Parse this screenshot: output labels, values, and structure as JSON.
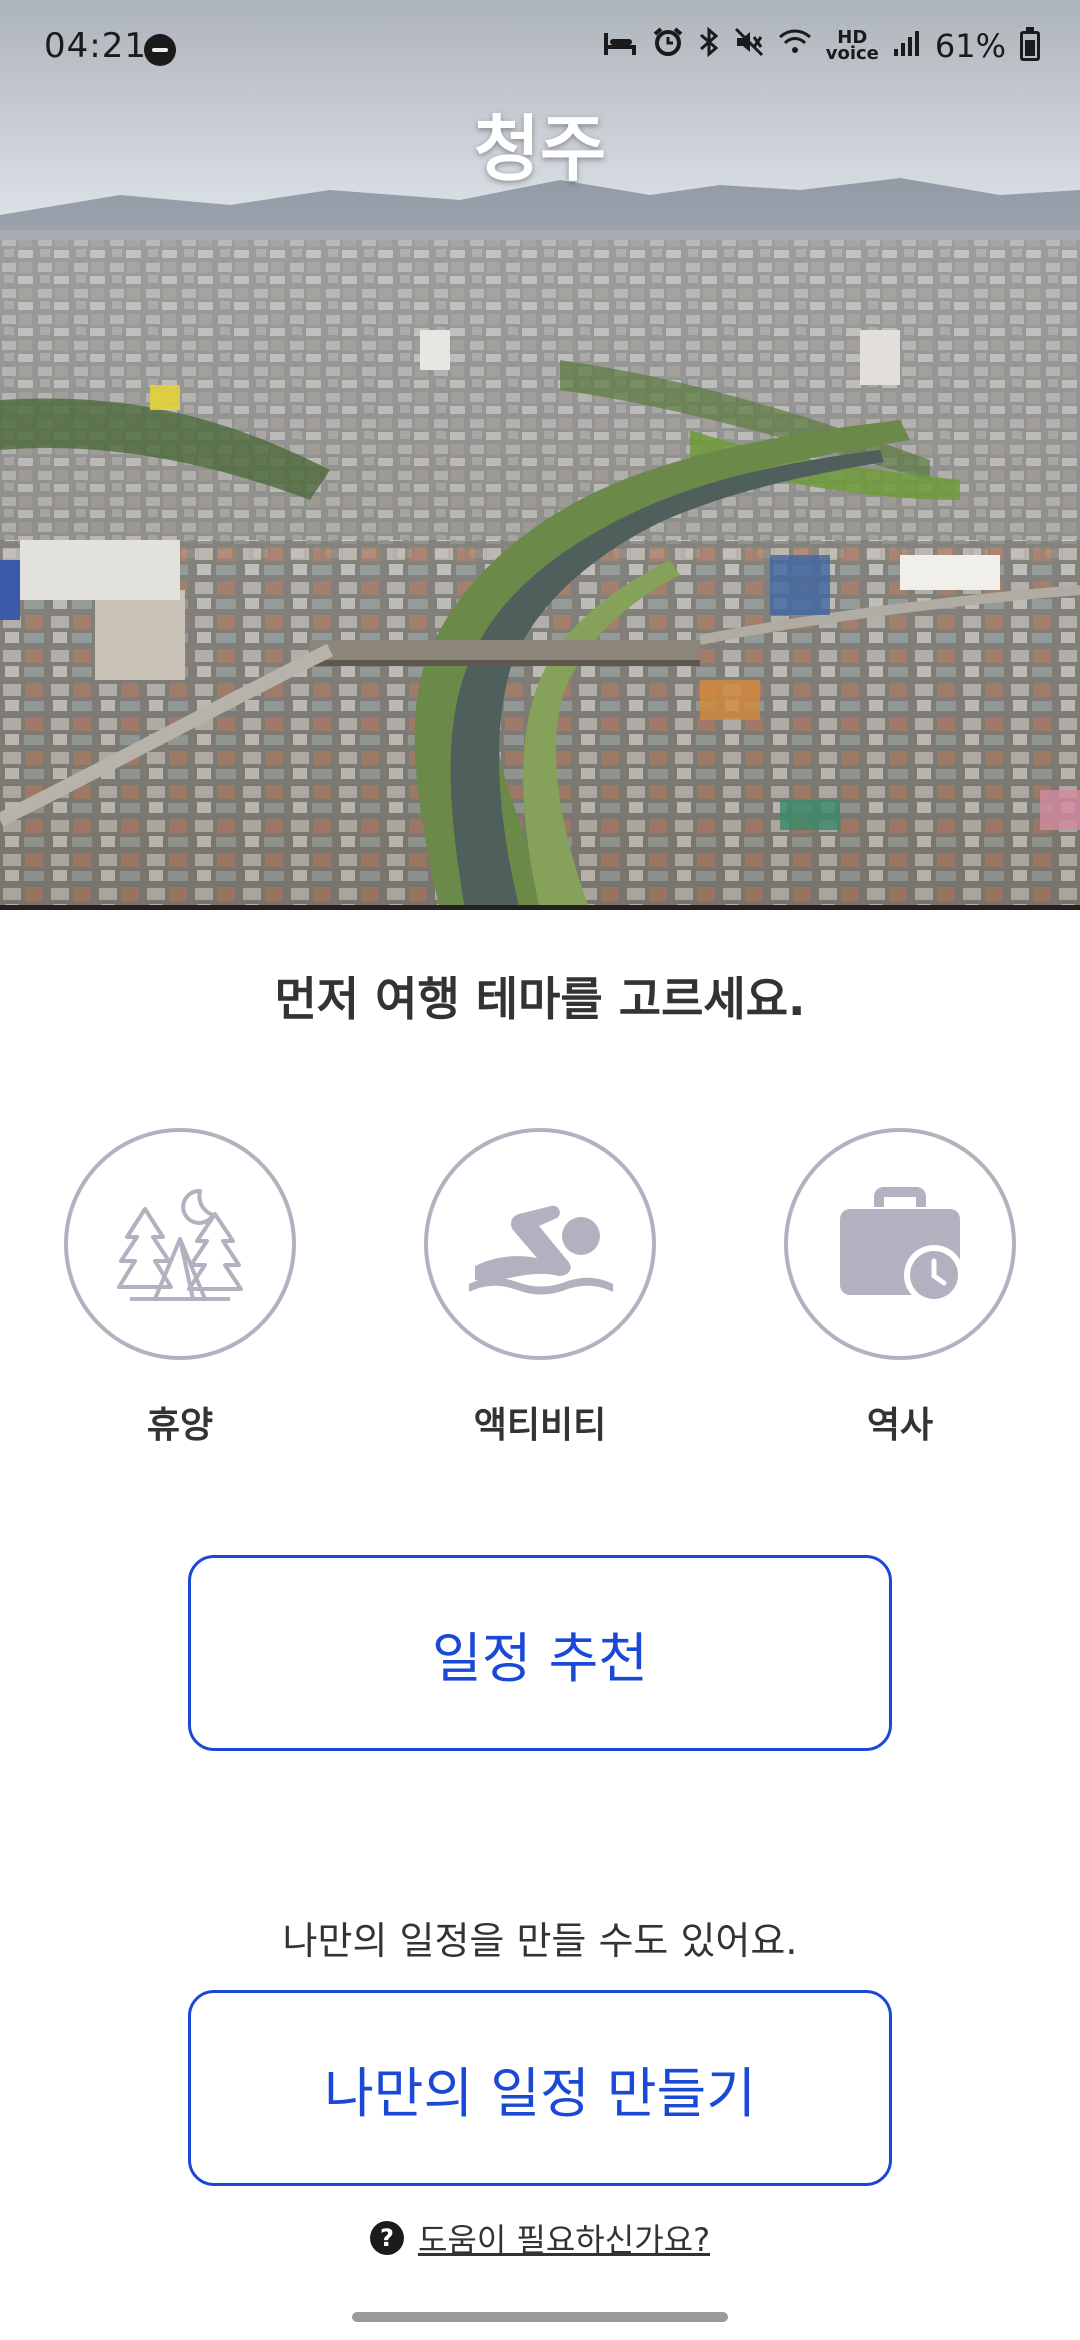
{
  "status_bar": {
    "time": "04:21",
    "battery": "61%",
    "icons": [
      "dnd-icon",
      "sleep-icon",
      "alarm-icon",
      "bluetooth-icon",
      "mute-icon",
      "wifi-icon",
      "hd-voice-icon",
      "signal-icon",
      "battery-icon"
    ],
    "hd_voice_line1": "HD",
    "hd_voice_line2": "voice"
  },
  "hero": {
    "city": "청주"
  },
  "prompt": "먼저 여행 테마를 고르세요.",
  "themes": [
    {
      "label": "휴양",
      "icon": "camping-tent-icon"
    },
    {
      "label": "액티비티",
      "icon": "swimmer-icon"
    },
    {
      "label": "역사",
      "icon": "briefcase-clock-icon"
    }
  ],
  "recommend_button": "일정 추천",
  "custom_prompt": "나만의 일정을 만들 수도 있어요.",
  "custom_button": "나만의 일정 만들기",
  "help": {
    "icon_glyph": "?",
    "text": "도움이 필요하신가요?"
  },
  "colors": {
    "accent": "#1a49d6",
    "icon_gray": "#b2b1bf",
    "text": "#333333"
  }
}
